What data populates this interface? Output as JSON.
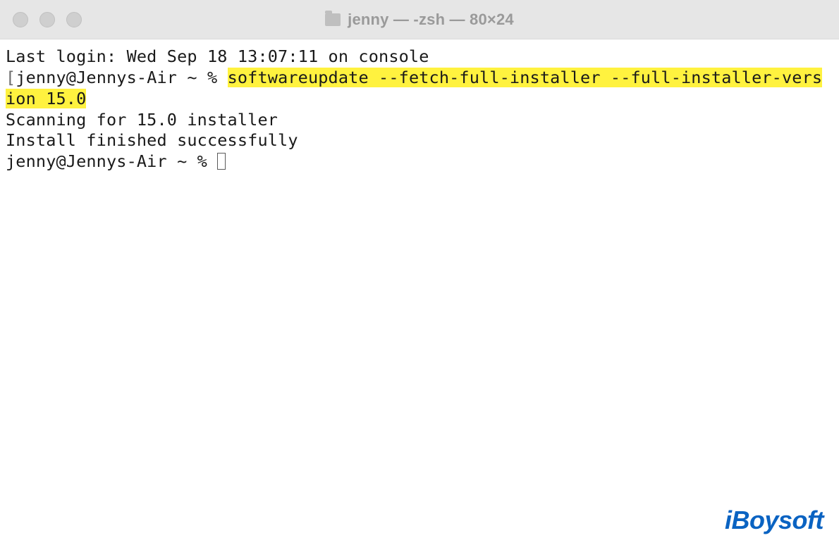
{
  "titlebar": {
    "title": "jenny — -zsh — 80×24"
  },
  "terminal": {
    "last_login": "Last login: Wed Sep 18 13:07:11 on console",
    "prompt1_prefix": "jenny@Jennys-Air ~ % ",
    "highlight_cmd_part1": "softwareupdate --fetch-full-installer --full-installer-vers",
    "highlight_cmd_part2": "ion 15.0",
    "output1": "Scanning for 15.0 installer",
    "output2": "Install finished successfully",
    "prompt2": "jenny@Jennys-Air ~ % "
  },
  "watermark": "iBoysoft"
}
